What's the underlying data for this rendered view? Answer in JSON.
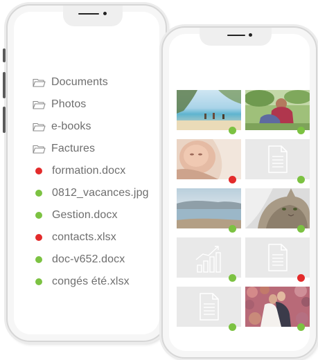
{
  "colors": {
    "green": "#7cc242",
    "red": "#e32b2b",
    "text": "#6e6e6e"
  },
  "file_list": [
    {
      "kind": "folder",
      "label": "Documents",
      "icon": "folder-icon"
    },
    {
      "kind": "folder",
      "label": "Photos",
      "icon": "folder-icon"
    },
    {
      "kind": "folder",
      "label": "e-books",
      "icon": "folder-icon"
    },
    {
      "kind": "folder",
      "label": "Factures",
      "icon": "folder-icon"
    },
    {
      "kind": "file",
      "label": "formation.docx",
      "status": "red"
    },
    {
      "kind": "file",
      "label": "0812_vacances.jpg",
      "status": "green"
    },
    {
      "kind": "file",
      "label": "Gestion.docx",
      "status": "green"
    },
    {
      "kind": "file",
      "label": "contacts.xlsx",
      "status": "red"
    },
    {
      "kind": "file",
      "label": "doc-v652.docx",
      "status": "green"
    },
    {
      "kind": "file",
      "label": "congés été.xlsx",
      "status": "green"
    }
  ],
  "thumbnails": [
    {
      "type": "beach-photo",
      "status": "green"
    },
    {
      "type": "couple-photo",
      "status": "green"
    },
    {
      "type": "baby-photo",
      "status": "red"
    },
    {
      "type": "document-icon",
      "status": "green"
    },
    {
      "type": "sea-photo",
      "status": "green"
    },
    {
      "type": "cat-photo",
      "status": "green"
    },
    {
      "type": "chart-icon",
      "status": "green"
    },
    {
      "type": "document-icon",
      "status": "red"
    },
    {
      "type": "document-icon",
      "status": "green"
    },
    {
      "type": "wedding-photo",
      "status": "green"
    }
  ]
}
